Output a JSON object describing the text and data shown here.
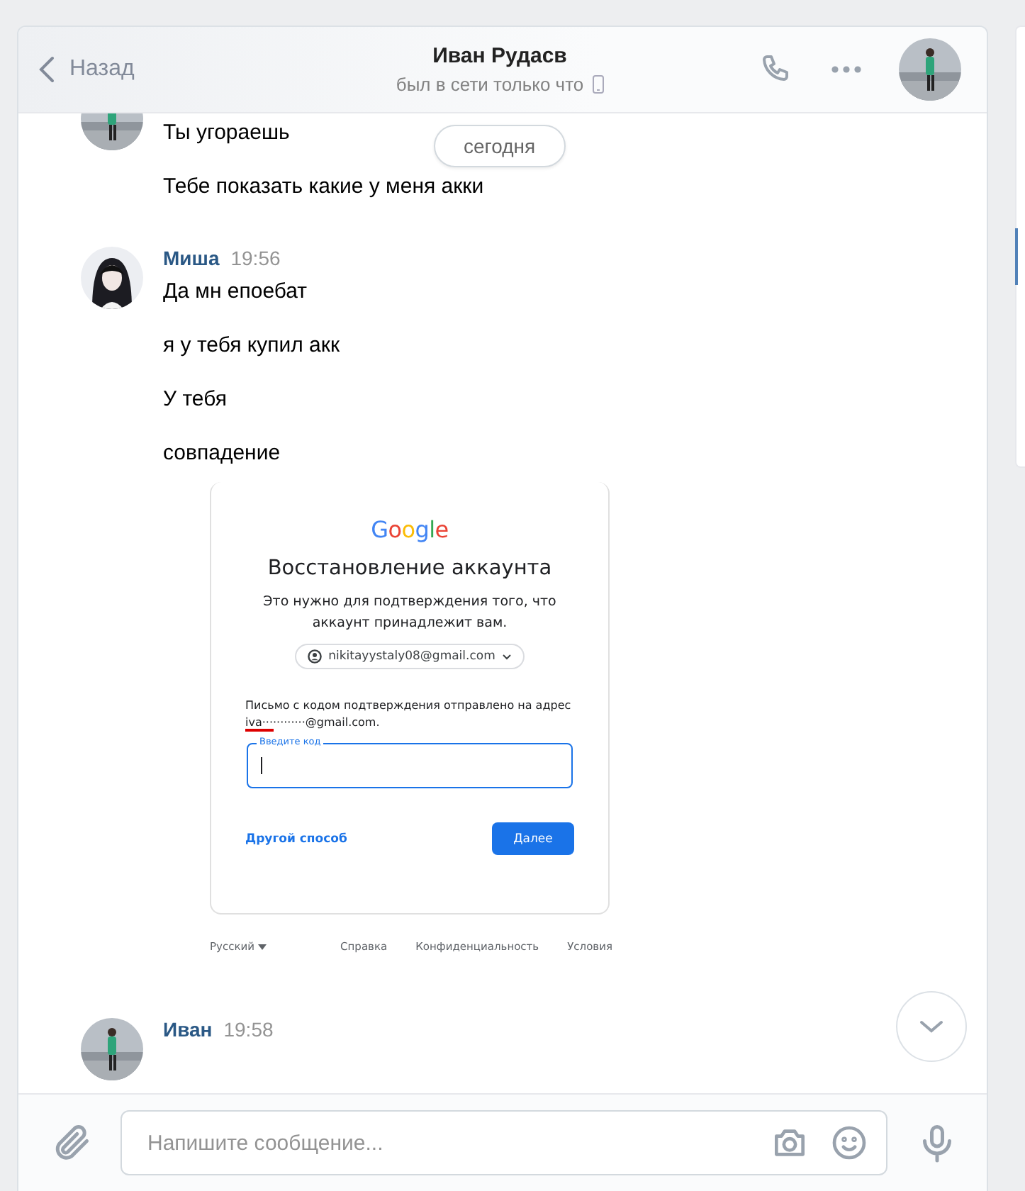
{
  "header": {
    "back_label": "Назад",
    "name": "Иван Рудасв",
    "status": "был в сети только что"
  },
  "date_pill": "сегодня",
  "message_groups": [
    {
      "messages": [
        {
          "kind": "text",
          "text": "Ты угораешь"
        },
        {
          "kind": "text",
          "text": "Тебе показать какие у меня акки"
        }
      ]
    },
    {
      "author": "Миша",
      "time": "19:56",
      "messages": [
        {
          "kind": "text",
          "text": "Да мн епоебат"
        },
        {
          "kind": "text",
          "text": "я у тебя купил акк"
        },
        {
          "kind": "text",
          "text": "У тебя"
        },
        {
          "kind": "text",
          "text": "совпадение"
        },
        {
          "kind": "screenshot"
        }
      ]
    },
    {
      "author": "Иван",
      "time": "19:58"
    }
  ],
  "screenshot": {
    "logo": "Google",
    "title": "Восстановление аккаунта",
    "subtitle": "Это нужно для подтверждения того, что аккаунт принадлежит вам.",
    "account_email": "nikitayystaly08@gmail.com",
    "notice": "Письмо с кодом подтверждения отправлено на адрес",
    "masked_email": "iva············@gmail.com.",
    "field_label": "Введите код",
    "alt_link": "Другой способ",
    "next_button": "Далее",
    "footer": {
      "language": "Русский",
      "links": [
        "Справка",
        "Конфиденциальность",
        "Условия"
      ]
    }
  },
  "composer": {
    "placeholder": "Напишите сообщение..."
  }
}
